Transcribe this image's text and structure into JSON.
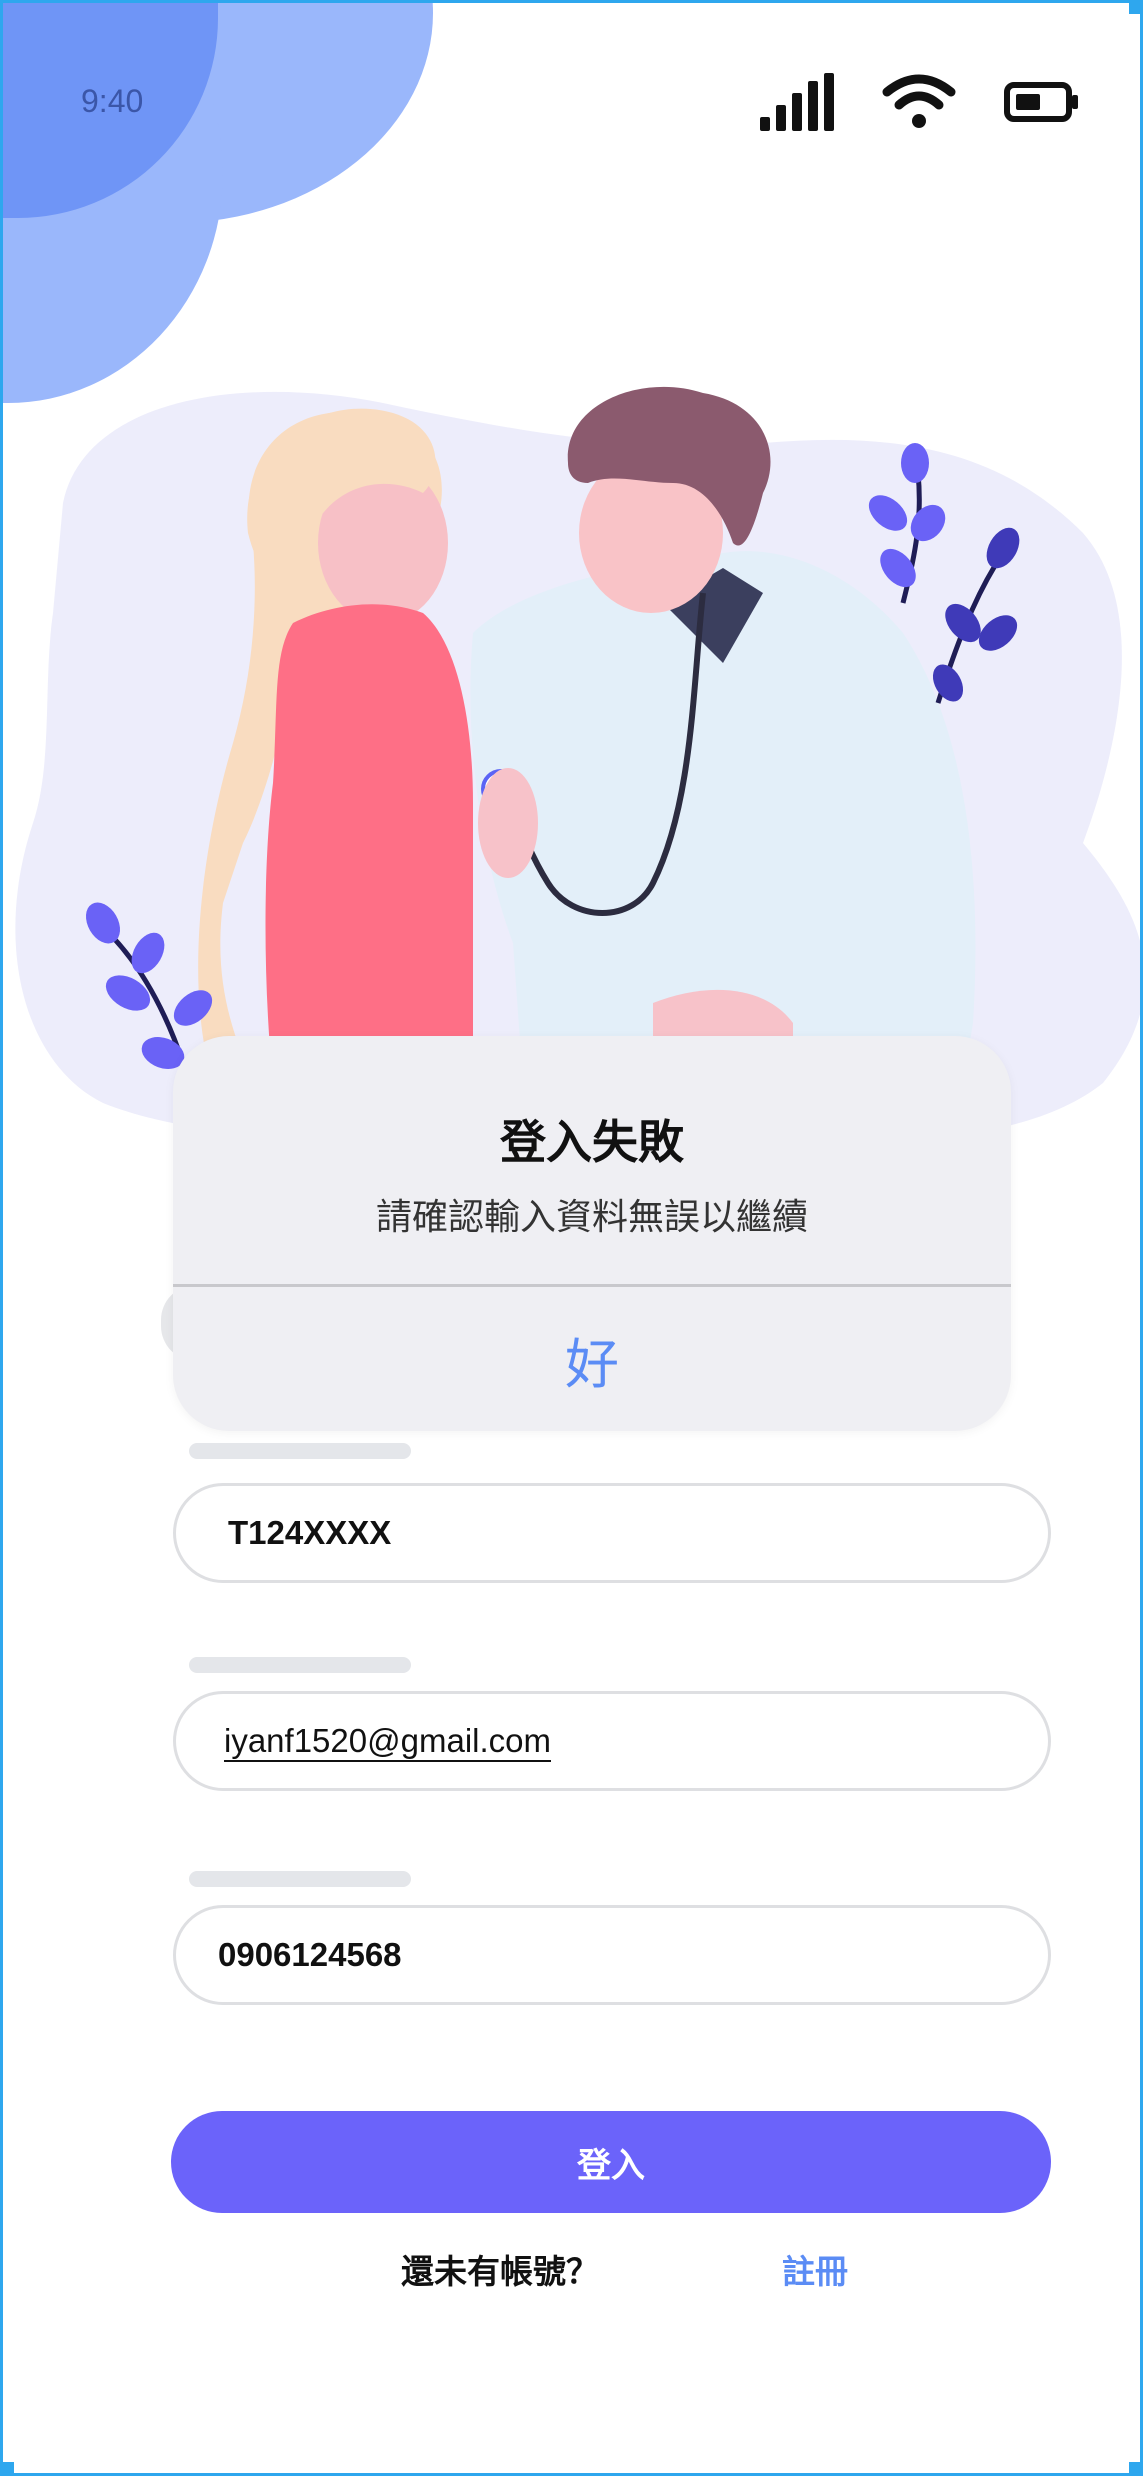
{
  "status_bar": {
    "time": "9:40",
    "icons": [
      "cellular-signal-icon",
      "wifi-icon",
      "battery-icon"
    ]
  },
  "illustration": {
    "description_icon": "doctor-with-patient-illustration"
  },
  "alert": {
    "title": "登入失敗",
    "message": "請確認輸入資料無誤以繼續",
    "ok_label": "好"
  },
  "form": {
    "id_number": {
      "value": "T124XXXX"
    },
    "email": {
      "value": "iyanf1520@gmail.com"
    },
    "phone": {
      "value": "0906124568"
    }
  },
  "login_button": {
    "label": "登入"
  },
  "footer": {
    "no_account": "還未有帳號？",
    "register": "註冊"
  },
  "colors": {
    "accent": "#6B63FA",
    "link": "#5B8CF5",
    "blob": "#9AB7FB",
    "frame": "#2EA7EE"
  }
}
